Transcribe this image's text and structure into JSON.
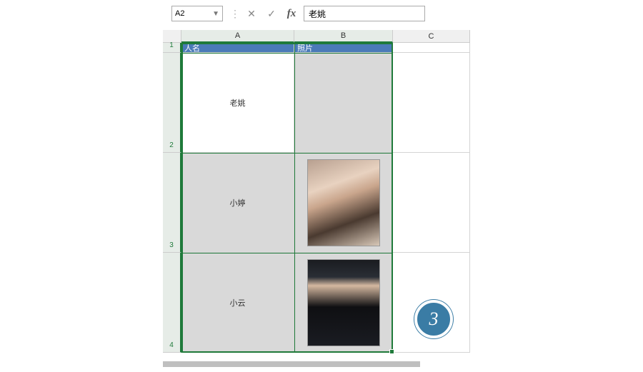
{
  "formula_bar": {
    "name_box": "A2",
    "formula_value": "老姚",
    "cancel_glyph": "✕",
    "confirm_glyph": "✓",
    "fx_label": "fx"
  },
  "columns": {
    "a": "A",
    "b": "B",
    "c": "C"
  },
  "row_numbers": {
    "r1": "1",
    "r2": "2",
    "r3": "3",
    "r4": "4"
  },
  "headers": {
    "name": "人名",
    "photo": "照片"
  },
  "rows": [
    {
      "name": "老姚"
    },
    {
      "name": "小婷"
    },
    {
      "name": "小云"
    }
  ],
  "step_badge": "3"
}
